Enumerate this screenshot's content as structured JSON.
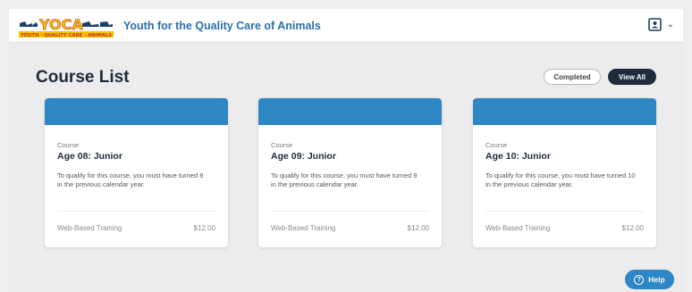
{
  "header": {
    "logo_text": "YOCA",
    "logo_subtext": "YOUTH QUALITY CARE ANIMALS",
    "site_title": "Youth for the Quality Care of Animals",
    "account_icon": "account-card-icon",
    "menu_icon": "chevron-down-icon"
  },
  "main": {
    "page_title": "Course List",
    "filters": {
      "completed_label": "Completed",
      "view_all_label": "View All"
    },
    "courses": [
      {
        "kicker": "Course",
        "title": "Age 08: Junior",
        "description": "To qualify for this course, you must have turned 8 in the previous calendar year.",
        "type": "Web-Based Training",
        "price": "$12.00"
      },
      {
        "kicker": "Course",
        "title": "Age 09: Junior",
        "description": "To qualify for this course, you must have turned 9 in the previous calendar year.",
        "type": "Web-Based Training",
        "price": "$12.00"
      },
      {
        "kicker": "Course",
        "title": "Age 10: Junior",
        "description": "To qualify for this course, you must have turned 10 in the previous calendar year.",
        "type": "Web-Based Training",
        "price": "$12.00"
      }
    ]
  },
  "help": {
    "label": "Help",
    "icon": "question-circle-icon"
  },
  "colors": {
    "brand_blue": "#2f86c4",
    "title_blue": "#2a6fab",
    "dark_navy": "#1e2b3d",
    "logo_yellow": "#f2c200",
    "logo_red": "#c8312b"
  }
}
